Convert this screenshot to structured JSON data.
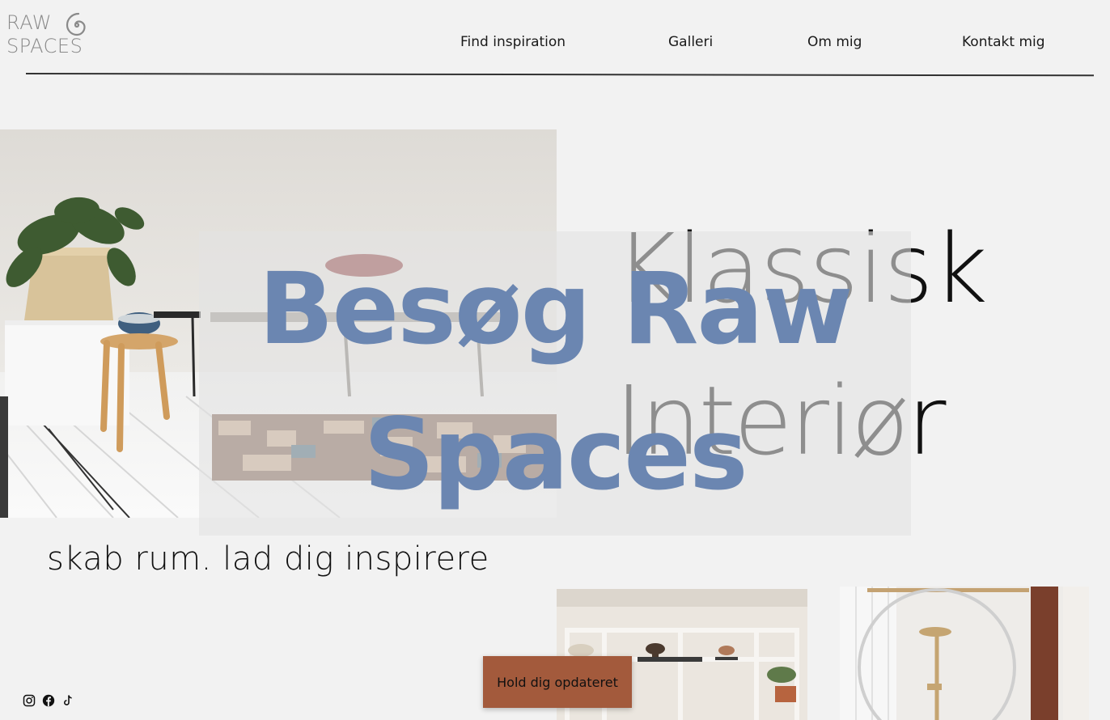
{
  "brand": {
    "line1": "RAW",
    "line2": "SPACES",
    "logo_icon": "spiral-icon"
  },
  "nav": {
    "items": [
      {
        "label": "Find inspiration"
      },
      {
        "label": "Galleri"
      },
      {
        "label": "Om mig"
      },
      {
        "label": "Kontakt mig"
      }
    ]
  },
  "hero": {
    "headline_line1": "Klassisk",
    "headline_line2": "Interiør",
    "overlay_line1": "Besøg Raw",
    "overlay_line2": "Spaces",
    "tagline": "skab rum. lad dig inspirere"
  },
  "newsletter": {
    "label": "Hold dig opdateret"
  },
  "social": {
    "icons": [
      "instagram-icon",
      "facebook-icon",
      "tiktok-icon"
    ]
  },
  "colors": {
    "background": "#f2f2f2",
    "overlay_text": "#6b86b1",
    "button": "#a35a3c"
  }
}
